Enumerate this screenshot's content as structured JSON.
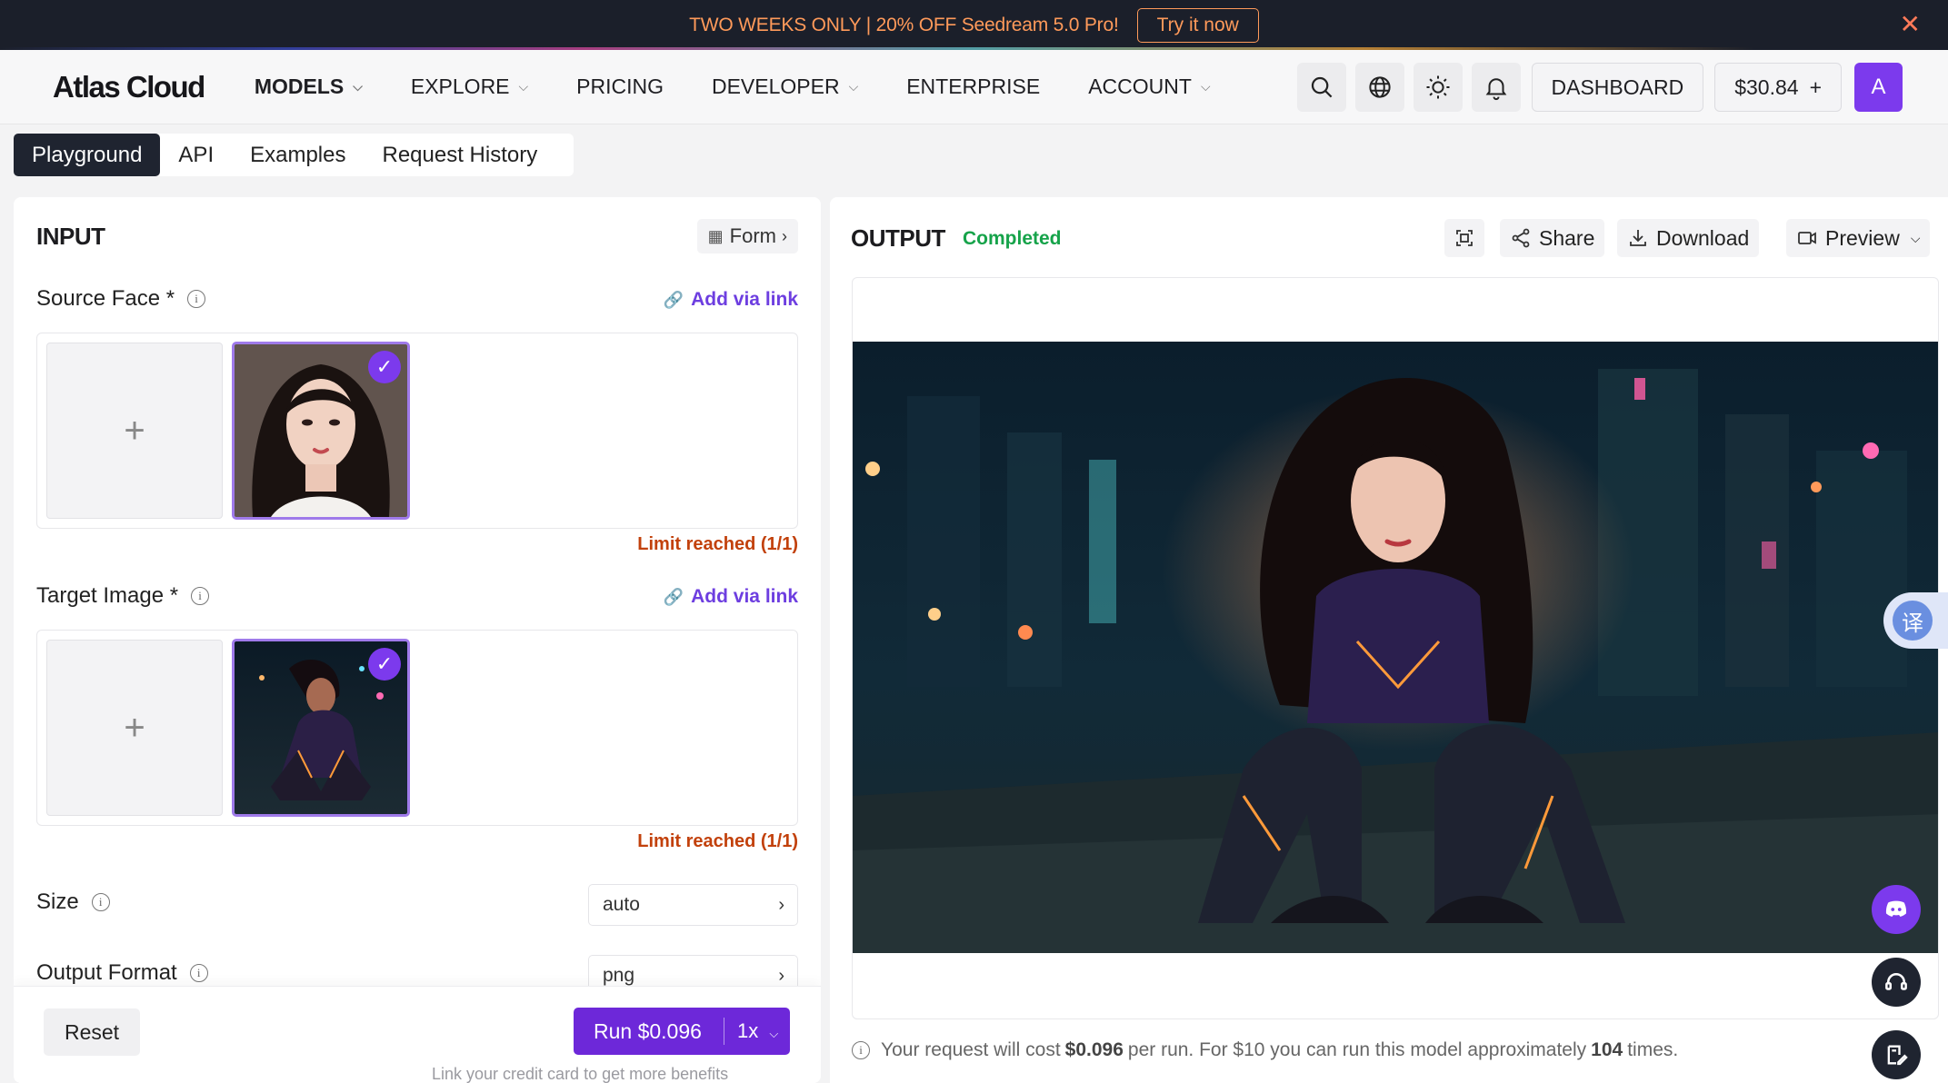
{
  "promo": {
    "text": "TWO WEEKS ONLY | 20% OFF Seedream 5.0 Pro!",
    "cta": "Try it now",
    "close": "✕"
  },
  "nav": {
    "logo": "Atlas Cloud",
    "menu": [
      {
        "label": "MODELS",
        "has_dropdown": true
      },
      {
        "label": "EXPLORE",
        "has_dropdown": true
      },
      {
        "label": "PRICING",
        "has_dropdown": false
      },
      {
        "label": "DEVELOPER",
        "has_dropdown": true
      },
      {
        "label": "ENTERPRISE",
        "has_dropdown": false
      },
      {
        "label": "ACCOUNT",
        "has_dropdown": true
      }
    ],
    "icons": [
      "search-icon",
      "globe-icon",
      "sun-icon",
      "bell-icon"
    ],
    "dashboard": "DASHBOARD",
    "balance": "$30.84",
    "balance_add": "+",
    "avatar_initial": "A"
  },
  "tabs": [
    "Playground",
    "API",
    "Examples",
    "Request History"
  ],
  "input": {
    "title": "INPUT",
    "form_toggle": "Form",
    "source_face": {
      "label": "Source Face *",
      "add_link": "Add via link",
      "limit": "Limit reached (1/1)"
    },
    "target_image": {
      "label": "Target Image *",
      "add_link": "Add via link",
      "limit": "Limit reached (1/1)"
    },
    "size": {
      "label": "Size",
      "value": "auto"
    },
    "output_format": {
      "label": "Output Format",
      "value": "png"
    },
    "reset": "Reset",
    "run": "Run $0.096",
    "multiplier": "1x",
    "credit_hint": "Link your credit card to get more benefits"
  },
  "output": {
    "title": "OUTPUT",
    "status": "Completed",
    "share": "Share",
    "download": "Download",
    "preview": "Preview",
    "cost_prefix": "Your request will cost",
    "cost": "$0.096",
    "cost_mid": "per run. For $10 you can run this model approximately",
    "runs": "104",
    "cost_suffix": "times."
  },
  "colors": {
    "accent": "#6d28d9",
    "promo_bg": "#1b1f2a",
    "promo_text": "#ff9a5a",
    "status_green": "#16a34a",
    "limit_red": "#c2410c"
  }
}
